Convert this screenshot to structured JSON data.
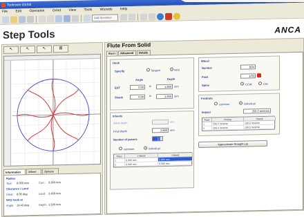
{
  "window": {
    "title": "Toolroom iGrind",
    "controls": [
      "_",
      "□",
      "x"
    ]
  },
  "menu": [
    "File",
    "Edit",
    "Operation",
    "Grind",
    "View",
    "Tools",
    "Wizards",
    "Help"
  ],
  "toolbar": {
    "operation_combo": "Add Operation"
  },
  "page": {
    "title": "Step Tools",
    "logo": "ANCA"
  },
  "left": {
    "tool_glyphs": [
      "↖",
      "↖",
      "↖",
      "⊞"
    ],
    "tabs": [
      "Information",
      "Wheel",
      "Options"
    ],
    "info": {
      "radius_heading": "Radius",
      "tool_label": "Tool:",
      "tool_value": "6.000 mm",
      "corr_label": "Corr.:",
      "corr_value": "3.300 mm",
      "clearance_heading": "Clearance / Land",
      "clear_label": "Clear.:",
      "clear_value": "6.00 deg",
      "land_label": "Land:",
      "land_value": "2.430 mm",
      "nas_heading": "NAS hook at",
      "angle_label": "Angle:",
      "angle_value": "14.43 deg",
      "depth_label": "Depth:",
      "depth_value": "1.500 mm"
    }
  },
  "right": {
    "title": "Flute From Solid",
    "tabs": [
      "Basic",
      "Advanced",
      "Details"
    ],
    "hook": {
      "title": "Hook",
      "specify_label": "Specify",
      "tangent_label": "Tangent",
      "nas_label": "NAS",
      "angle_header": "Angle",
      "depth_header": "Depth",
      "edt_label": "EDT",
      "edt_angle": "0.00",
      "edt_depth": "1.833",
      "shank_label": "Shank",
      "shank_angle": "0.00",
      "shank_depth": "1.833",
      "eq": "=",
      "unit": "mm"
    },
    "wheel": {
      "title": "Wheel",
      "number_label": "Number",
      "number_value": "B04",
      "pack_label": "Pack",
      "pack_value": "1/03",
      "spins_label": "Spins",
      "ccw_label": "CCW",
      "cw_label": "CW"
    },
    "infeeds": {
      "title": "Infeeds",
      "initial_depth_label": "Initial depth",
      "initial_depth_unit": "mm",
      "final_depth_label": "Final depth",
      "final_depth_value": "2.800",
      "unit": "mm",
      "passes_label": "Number of passes",
      "passes_value": "2",
      "common_label": "common",
      "individual_label": "individual",
      "table_headers": [
        "Pass",
        "I Infeed",
        "I Infeed"
      ],
      "rows": [
        [
          "1",
          "0.000 mm",
          "2.800 mm"
        ],
        [
          "2",
          "0.000 mm",
          "0.000 mm"
        ]
      ]
    },
    "feedrate": {
      "title": "Feedrate",
      "common_label": "common",
      "individual_label": "individual",
      "impact_label": "Impact",
      "impact_value": "250.0 mm/min",
      "table_headers": [
        "Pass",
        "Fluting",
        "Shank"
      ],
      "rows": [
        [
          "1",
          "200.0 mm/min",
          "100.0 mm/min"
        ],
        [
          "2",
          "200.0 mm/min",
          "100.0 mm/min"
        ]
      ]
    },
    "approx_button": "Approximate Straight Lip"
  }
}
